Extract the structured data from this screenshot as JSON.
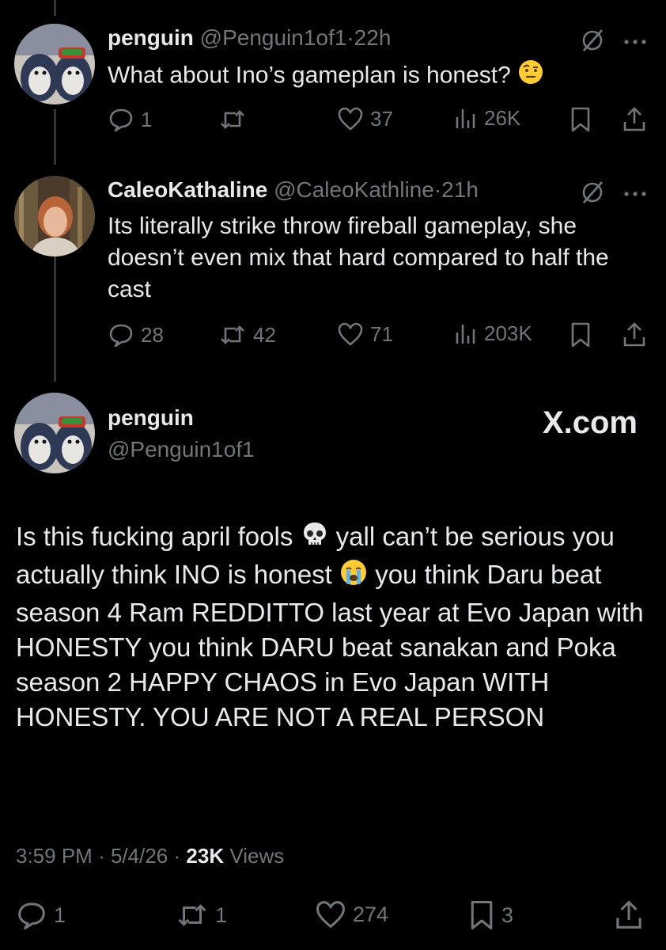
{
  "reply1": {
    "name": "penguin",
    "handle": "@Penguin1of1",
    "dot": "·",
    "time": "22h",
    "text": "What about Ino’s gameplan is honest?",
    "emoji_icon": "raised-eyebrow-emoji",
    "replies": "1",
    "reposts": "",
    "likes": "37",
    "views": "26K"
  },
  "reply2": {
    "name": "CaleoKathaline",
    "handle": "@CaleoKathline",
    "dot": "·",
    "time": "21h",
    "text": "Its literally strike throw fireball gameplay, she doesn’t even mix that hard compared to half the cast",
    "replies": "28",
    "reposts": "42",
    "likes": "71",
    "views": "203K"
  },
  "main": {
    "name": "penguin",
    "handle": "@Penguin1of1",
    "brand": "X.com",
    "text_part1": "Is this fucking april fools",
    "text_part2": " yall can’t be serious you actually think INO is honest",
    "text_part3": " you think Daru beat season 4 Ram REDDITTO last year at Evo Japan with HONESTY you think DARU beat sanakan and Poka season 2 HAPPY CHAOS in Evo Japan WITH HONESTY. YOU ARE NOT A REAL PERSON",
    "emoji1_icon": "skull-emoji",
    "emoji2_icon": "crying-face-emoji",
    "time": "3:59 PM",
    "sep": "·",
    "date": "5/4/26",
    "views_count": "23K",
    "views_label": "Views",
    "replies": "1",
    "reposts": "1",
    "likes": "274",
    "bookmarks": "3"
  },
  "colors": {
    "background": "#000000",
    "text": "#e7e9ea",
    "muted": "#71767b",
    "thread_line": "#333639"
  }
}
